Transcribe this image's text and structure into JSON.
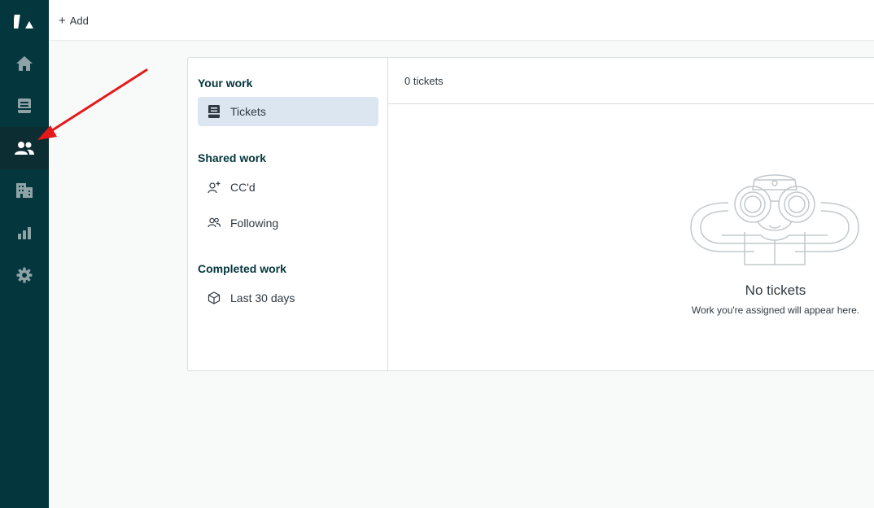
{
  "topbar": {
    "add_label": "Add"
  },
  "sidebar": {
    "items": [
      {
        "name": "logo"
      },
      {
        "name": "home"
      },
      {
        "name": "views"
      },
      {
        "name": "customers"
      },
      {
        "name": "organizations"
      },
      {
        "name": "reporting"
      },
      {
        "name": "admin"
      }
    ]
  },
  "views": {
    "your_work_title": "Your work",
    "tickets_label": "Tickets",
    "shared_work_title": "Shared work",
    "ccd_label": "CC'd",
    "following_label": "Following",
    "completed_work_title": "Completed work",
    "last30_label": "Last 30 days"
  },
  "content": {
    "ticket_count": "0 tickets",
    "empty_title": "No tickets",
    "empty_subtitle": "Work you're assigned will appear here."
  },
  "colors": {
    "sidebar_bg": "#03363d",
    "active_view_bg": "#dce6f1",
    "annotation_arrow": "#e3191b"
  }
}
